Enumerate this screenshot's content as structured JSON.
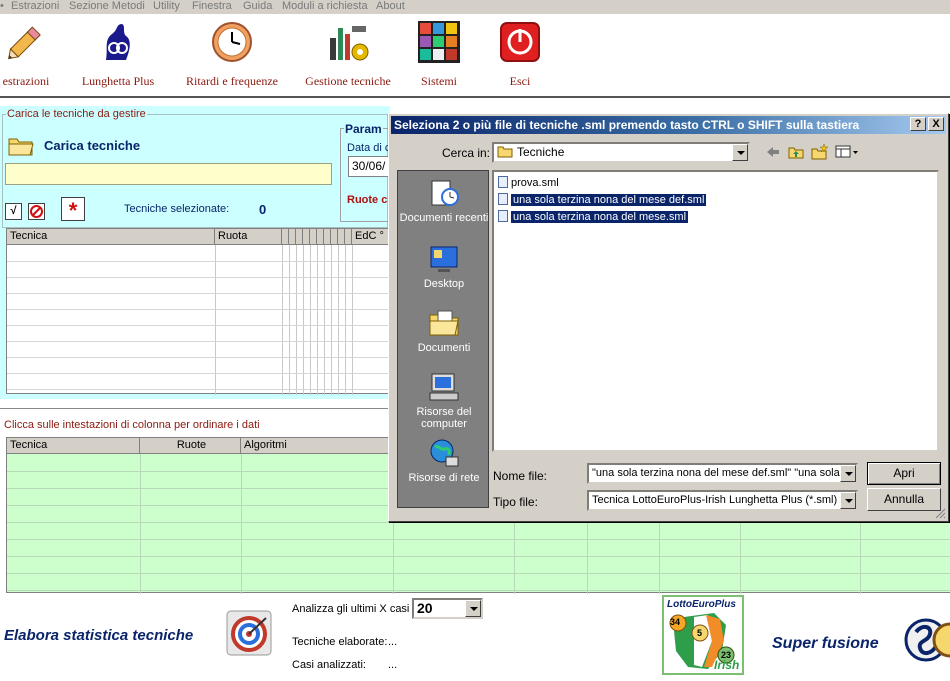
{
  "menu": [
    "Estrazioni",
    "Sezione Metodi",
    "Utility",
    "Finestra",
    "Guida",
    "Moduli a richiesta",
    "About"
  ],
  "toolbar": {
    "estrazioni": "estrazioni",
    "lunghetta": "Lunghetta Plus",
    "ritardi": "Ritardi e frequenze",
    "gestione": "Gestione tecniche",
    "sistemi": "Sistemi",
    "esci": "Esci"
  },
  "carica": {
    "group_title": "Carica le tecniche da gestire",
    "button_label": "Carica tecniche",
    "path_value": "",
    "selected_label": "Tecniche selezionate:",
    "selected_count": "0",
    "check_glyph": "√",
    "star_glyph": "*"
  },
  "param": {
    "title": "Param",
    "date_label": "Data di c",
    "date_value": "30/06/",
    "ruote_label": "Ruote c"
  },
  "grid_top": {
    "col_tecnica": "Tecnica",
    "col_ruota": "Ruota",
    "col_edc": "EdC °"
  },
  "sort_hint": "Clicca sulle intestazioni di colonna per ordinare i dati",
  "grid_bottom": {
    "col_tecnica": "Tecnica",
    "col_ruote": "Ruote",
    "col_algoritmi": "Algoritmi"
  },
  "footer": {
    "elabora": "Elabora statistica tecniche",
    "analizza_label": "Analizza gli ultimi X casi",
    "analizza_value": "20",
    "elaborate_label": "Tecniche elaborate:",
    "elaborate_value": "...",
    "casi_label": "Casi analizzati:",
    "casi_value": "...",
    "logo_top": "LottoEuroPlus",
    "logo_bottom": "Irish",
    "logo_n1": "34",
    "logo_n2": "5",
    "logo_n3": "23",
    "super": "Super fusione"
  },
  "dialog": {
    "title": "Seleziona 2 o più file di tecniche .sml premendo tasto CTRL o SHIFT sulla tastiera",
    "help": "?",
    "close": "X",
    "cerca_label": "Cerca in:",
    "cerca_value": "Tecniche",
    "places": [
      "Documenti recenti",
      "Desktop",
      "Documenti",
      "Risorse del computer",
      "Risorse di rete"
    ],
    "files": [
      {
        "name": "prova.sml",
        "selected": false
      },
      {
        "name": "una sola terzina nona del mese def.sml",
        "selected": true
      },
      {
        "name": "una sola terzina nona del mese.sml",
        "selected": true
      }
    ],
    "nome_label": "Nome file:",
    "nome_value": "\"una sola terzina nona del mese def.sml\" \"una sola te",
    "tipo_label": "Tipo file:",
    "tipo_value": "Tecnica LottoEuroPlus-Irish Lunghetta Plus (*.sml)",
    "apri": "Apri",
    "annulla": "Annulla"
  },
  "colors": {
    "panel_cyan": "#ccffff",
    "grid_green": "#ccffcc",
    "title_blue": "#0a246a",
    "label_red": "#8b1a10",
    "path_yellow": "#ffffcc"
  }
}
